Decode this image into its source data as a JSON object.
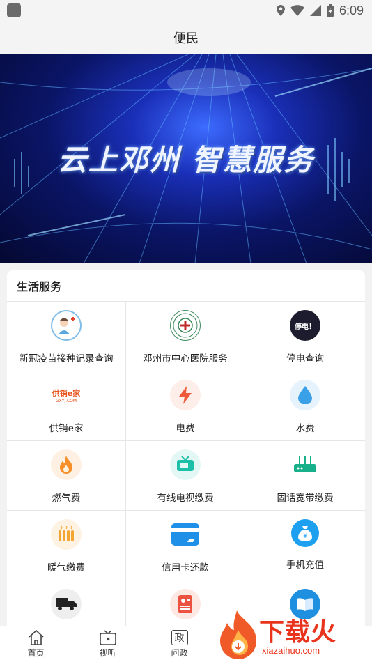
{
  "status": {
    "time": "6:09"
  },
  "header": {
    "title": "便民"
  },
  "banner": {
    "text": "云上邓州 智慧服务"
  },
  "section": {
    "title": "生活服务",
    "items": [
      {
        "label": "新冠疫苗接种记录查询",
        "icon": "nurse-icon"
      },
      {
        "label": "邓州市中心医院服务",
        "icon": "hospital-logo-icon"
      },
      {
        "label": "停电查询",
        "icon": "power-outage-icon",
        "badge": "停电！"
      },
      {
        "label": "供销e家",
        "icon": "gxej-logo-icon",
        "logo_text": "供销e家",
        "logo_sub": "GXYJ.COM"
      },
      {
        "label": "电费",
        "icon": "lightning-icon"
      },
      {
        "label": "水费",
        "icon": "water-drop-icon"
      },
      {
        "label": "燃气费",
        "icon": "flame-icon"
      },
      {
        "label": "有线电视缴费",
        "icon": "tv-icon"
      },
      {
        "label": "固话宽带缴费",
        "icon": "router-icon"
      },
      {
        "label": "暖气缴费",
        "icon": "heater-icon"
      },
      {
        "label": "信用卡还款",
        "icon": "credit-card-icon"
      },
      {
        "label": "手机充值",
        "icon": "money-bag-icon"
      },
      {
        "label": "",
        "icon": "truck-icon"
      },
      {
        "label": "",
        "icon": "id-card-icon"
      },
      {
        "label": "",
        "icon": "book-icon"
      }
    ]
  },
  "tabs": [
    {
      "label": "首页",
      "icon": "home-icon"
    },
    {
      "label": "视听",
      "icon": "tv-tab-icon"
    },
    {
      "label": "问政",
      "icon": "zheng-icon",
      "glyph": "政"
    }
  ],
  "watermark": {
    "text": "下载火",
    "url": "xiazaihuo.com"
  },
  "colors": {
    "accent": "#e8341c",
    "banner": "#0a1566"
  }
}
